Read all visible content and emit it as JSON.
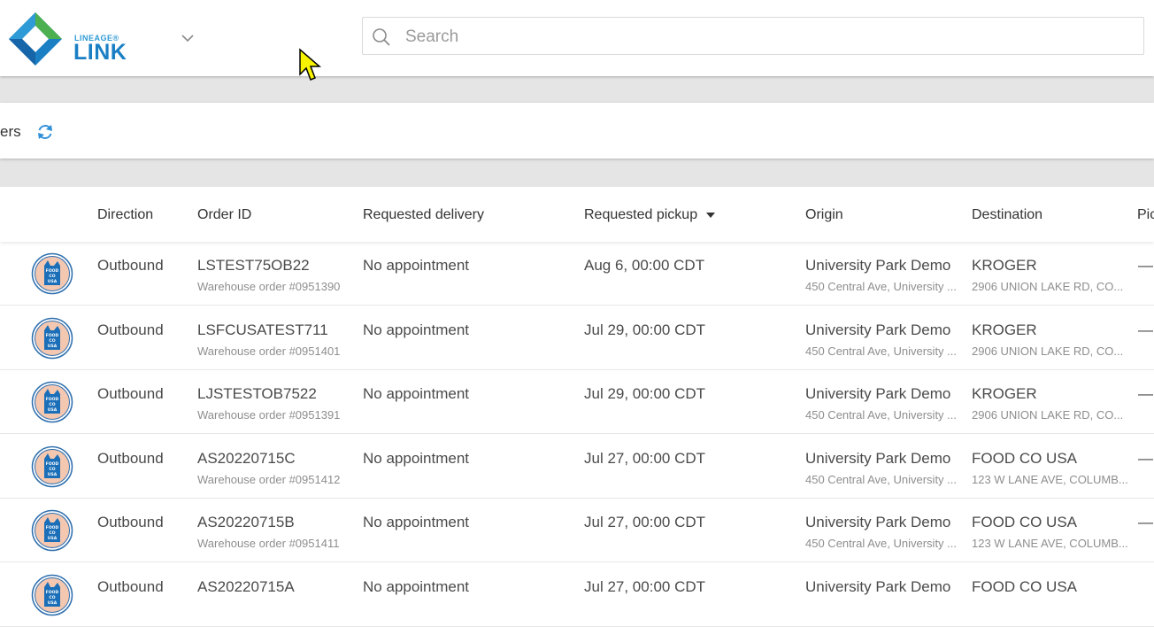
{
  "brand": {
    "logo_small": "LINEAGE®",
    "logo_big": "LINK"
  },
  "search": {
    "placeholder": "Search"
  },
  "page": {
    "title_fragment": "ers"
  },
  "columns": {
    "direction": "Direction",
    "order_id": "Order ID",
    "requested_delivery": "Requested delivery",
    "requested_pickup": "Requested pickup",
    "origin": "Origin",
    "destination": "Destination",
    "cut_column": "Pic"
  },
  "rows": [
    {
      "direction": "Outbound",
      "order_id": "LSTEST75OB22",
      "warehouse_order": "Warehouse order #0951390",
      "delivery": "No appointment",
      "pickup": "Aug 6, 00:00 CDT",
      "origin": "University Park Demo",
      "origin_address": "450 Central Ave, University ...",
      "destination": "KROGER",
      "destination_address": "2906 UNION LAKE RD, CO...",
      "extra": "—"
    },
    {
      "direction": "Outbound",
      "order_id": "LSFCUSATEST711",
      "warehouse_order": "Warehouse order #0951401",
      "delivery": "No appointment",
      "pickup": "Jul 29, 00:00 CDT",
      "origin": "University Park Demo",
      "origin_address": "450 Central Ave, University ...",
      "destination": "KROGER",
      "destination_address": "2906 UNION LAKE RD, CO...",
      "extra": "—"
    },
    {
      "direction": "Outbound",
      "order_id": "LJSTESTOB7522",
      "warehouse_order": "Warehouse order #0951391",
      "delivery": "No appointment",
      "pickup": "Jul 29, 00:00 CDT",
      "origin": "University Park Demo",
      "origin_address": "450 Central Ave, University ...",
      "destination": "KROGER",
      "destination_address": "2906 UNION LAKE RD, CO...",
      "extra": "—"
    },
    {
      "direction": "Outbound",
      "order_id": "AS20220715C",
      "warehouse_order": "Warehouse order #0951412",
      "delivery": "No appointment",
      "pickup": "Jul 27, 00:00 CDT",
      "origin": "University Park Demo",
      "origin_address": "450 Central Ave, University ...",
      "destination": "FOOD CO USA",
      "destination_address": "123 W LANE AVE, COLUMB...",
      "extra": "—"
    },
    {
      "direction": "Outbound",
      "order_id": "AS20220715B",
      "warehouse_order": "Warehouse order #0951411",
      "delivery": "No appointment",
      "pickup": "Jul 27, 00:00 CDT",
      "origin": "University Park Demo",
      "origin_address": "450 Central Ave, University ...",
      "destination": "FOOD CO USA",
      "destination_address": "123 W LANE AVE, COLUMB...",
      "extra": "—"
    },
    {
      "direction": "Outbound",
      "order_id": "AS20220715A",
      "warehouse_order": "",
      "delivery": "No appointment",
      "pickup": "Jul 27, 00:00 CDT",
      "origin": "University Park Demo",
      "origin_address": "",
      "destination": "FOOD CO USA",
      "destination_address": "",
      "extra": ""
    }
  ],
  "avatar": {
    "icon": "food-co-usa-logo",
    "text_lines": [
      "FOOD",
      "CO",
      "USA"
    ]
  },
  "colors": {
    "brand_blue": "#1b7fc4",
    "brand_green": "#4caf50",
    "avatar_fill": "#f4c7b0",
    "avatar_ring": "#2f6fae"
  }
}
